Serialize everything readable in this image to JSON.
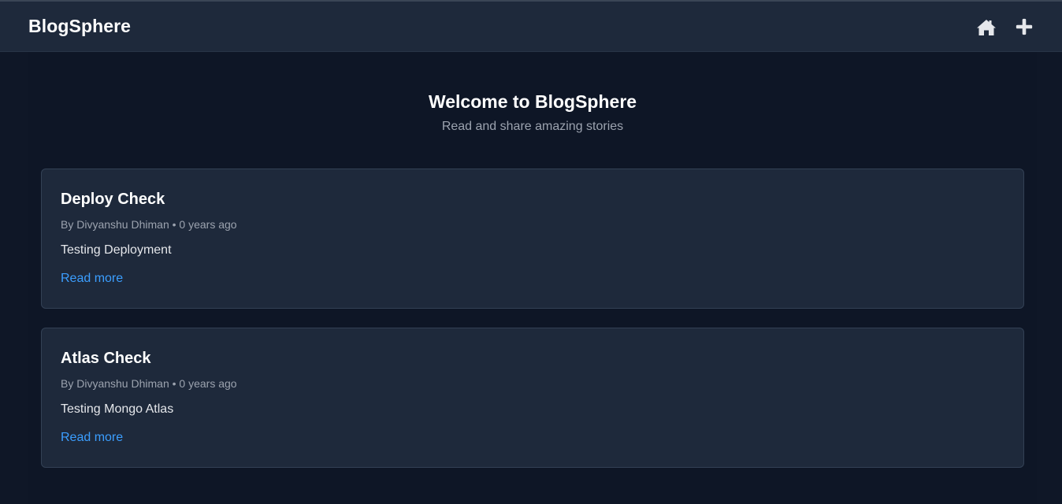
{
  "header": {
    "brand": "BlogSphere",
    "icons": [
      "home-icon",
      "plus-icon"
    ]
  },
  "hero": {
    "title": "Welcome to BlogSphere",
    "subtitle": "Read and share amazing stories"
  },
  "posts": [
    {
      "title": "Deploy Check",
      "meta": "By Divyanshu Dhiman • 0 years ago",
      "excerpt": "Testing Deployment",
      "link_label": "Read more"
    },
    {
      "title": "Atlas Check",
      "meta": "By Divyanshu Dhiman • 0 years ago",
      "excerpt": "Testing Mongo Atlas",
      "link_label": "Read more"
    }
  ],
  "colors": {
    "page_bg": "#0f1727",
    "surface": "#1e293b",
    "link": "#3b9eff",
    "muted_text": "#9ca3af"
  }
}
